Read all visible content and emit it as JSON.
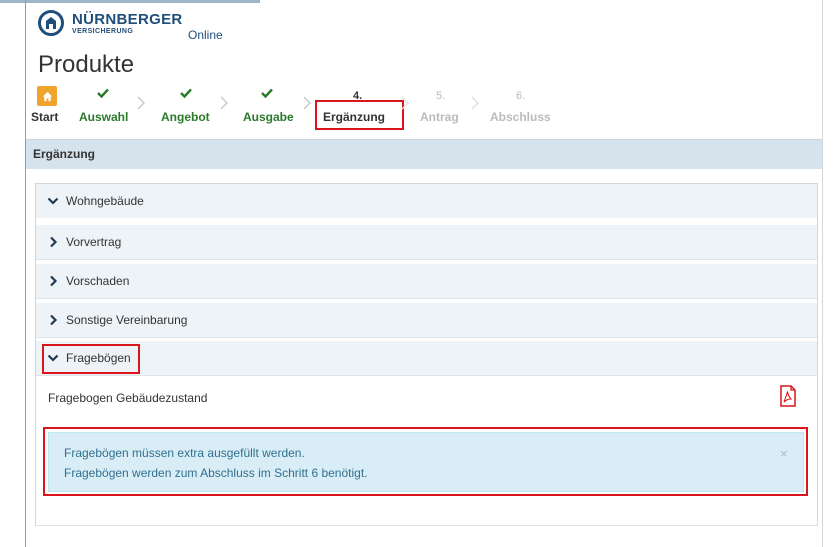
{
  "header": {
    "logo_main": "NÜRNBERGER",
    "logo_sub": "VERSICHERUNG",
    "logo_suffix": "Online"
  },
  "page": {
    "title": "Produkte"
  },
  "stepper": {
    "home_label": "Start",
    "steps": [
      {
        "label": "Auswahl",
        "status": "done"
      },
      {
        "label": "Angebot",
        "status": "done"
      },
      {
        "label": "Ausgabe",
        "status": "done"
      },
      {
        "number": "4.",
        "label": "Ergänzung",
        "status": "current"
      },
      {
        "number": "5.",
        "label": "Antrag",
        "status": "upcoming"
      },
      {
        "number": "6.",
        "label": "Abschluss",
        "status": "upcoming"
      }
    ]
  },
  "section": {
    "title": "Ergänzung"
  },
  "accordion": {
    "items": [
      {
        "label": "Wohngebäude",
        "expanded": true
      },
      {
        "label": "Vorvertrag",
        "expanded": false
      },
      {
        "label": "Vorschaden",
        "expanded": false
      },
      {
        "label": "Sonstige Vereinbarung",
        "expanded": false
      },
      {
        "label": "Fragebögen",
        "expanded": true
      }
    ],
    "fragebogen_item": "Fragebogen Gebäudezustand",
    "alert": {
      "line1": "Fragebögen müssen extra ausgefüllt werden.",
      "line2": "Fragebögen werden zum Abschluss im Schritt 6 benötigt.",
      "close": "×"
    }
  },
  "colors": {
    "brand": "#1f4e7a",
    "done_step": "#2a7a2a",
    "home_button": "#f0a42b",
    "highlight": "#d9161b",
    "alert_bg": "#d9edf7",
    "pdf_red": "#d9161b"
  },
  "icons": [
    "home-icon",
    "check-icon",
    "chevron-right-icon",
    "chevron-down-icon",
    "pdf-icon",
    "close-icon"
  ]
}
